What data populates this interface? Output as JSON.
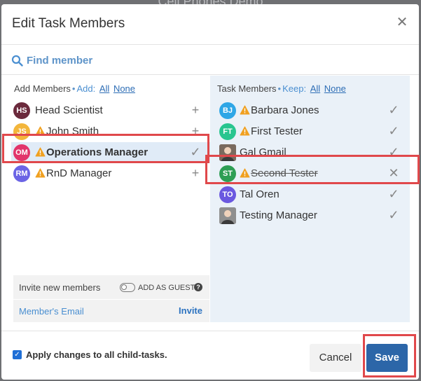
{
  "background": {
    "title": "Cell Phones Demo"
  },
  "dialog": {
    "title": "Edit Task Members",
    "close_icon": "close-icon"
  },
  "search": {
    "placeholder": "Find member",
    "icon": "search-icon"
  },
  "add_members": {
    "label": "Add Members",
    "add_label": "Add:",
    "all_label": "All",
    "none_label": "None",
    "items": [
      {
        "initials": "HS",
        "name": "Head Scientist",
        "color": "#6b2a3c",
        "warning": false,
        "action": "+"
      },
      {
        "initials": "JS",
        "name": "John Smith",
        "color": "#f3b63b",
        "warning": true,
        "action": "+"
      },
      {
        "initials": "OM",
        "name": "Operations Manager",
        "color": "#e2356b",
        "warning": true,
        "action": "✓",
        "selected": true
      },
      {
        "initials": "RM",
        "name": "RnD Manager",
        "color": "#6b64e5",
        "warning": true,
        "action": "+"
      }
    ]
  },
  "task_members": {
    "label": "Task Members",
    "keep_label": "Keep:",
    "all_label": "All",
    "none_label": "None",
    "items": [
      {
        "initials": "BJ",
        "name": "Barbara Jones",
        "color": "#2ea6e6",
        "warning": true,
        "action": "✓"
      },
      {
        "initials": "FT",
        "name": "First Tester",
        "color": "#28c58f",
        "warning": true,
        "action": "✓"
      },
      {
        "initials": "",
        "name": "Gal Gmail",
        "color": "#7a6a5e",
        "warning": false,
        "action": "✓",
        "photo": true
      },
      {
        "initials": "ST",
        "name": "Second Tester",
        "color": "#2e9e54",
        "warning": true,
        "action": "✕",
        "removed": true
      },
      {
        "initials": "TO",
        "name": "Tal Oren",
        "color": "#6a58e0",
        "warning": false,
        "action": "✓"
      },
      {
        "initials": "",
        "name": "Testing Manager",
        "color": "#8f8f8f",
        "warning": false,
        "action": "✓",
        "photo": true
      }
    ]
  },
  "invite": {
    "title": "Invite new members",
    "guest_label": "ADD AS GUEST",
    "help": "?",
    "email_placeholder": "Member's Email",
    "invite_label": "Invite"
  },
  "footer": {
    "apply_label": "Apply changes to all child-tasks.",
    "apply_checked": true,
    "cancel_label": "Cancel",
    "save_label": "Save"
  },
  "colors": {
    "accent": "#2c66a8",
    "link": "#2d6db5",
    "highlight": "#e0484b",
    "warning": "#f0a020"
  }
}
